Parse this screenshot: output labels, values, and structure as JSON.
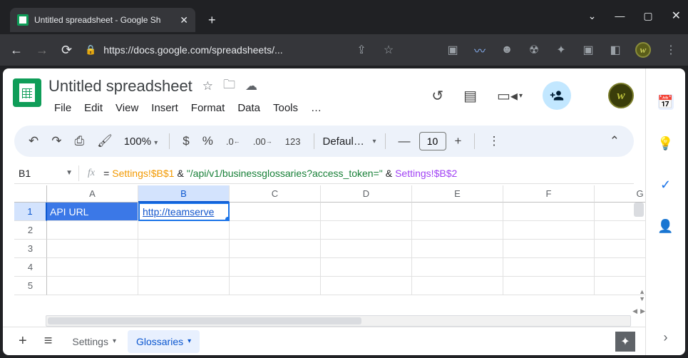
{
  "browser": {
    "tab_title": "Untitled spreadsheet - Google Sh",
    "url_display": "https://docs.google.com/spreadsheets/..."
  },
  "header": {
    "doc_title": "Untitled spreadsheet",
    "menus": [
      "File",
      "Edit",
      "View",
      "Insert",
      "Format",
      "Data",
      "Tools",
      "…"
    ]
  },
  "toolbar": {
    "zoom": "100%",
    "font": "Defaul…",
    "font_size": "10"
  },
  "formula_bar": {
    "cell_ref": "B1",
    "parts": [
      {
        "t": "eq",
        "v": "="
      },
      {
        "t": "ref",
        "v": "Settings!$B$1"
      },
      {
        "t": "op",
        "v": " & "
      },
      {
        "t": "str",
        "v": "\"/api/v1/businessglossaries?access_token=\""
      },
      {
        "t": "op",
        "v": " & "
      },
      {
        "t": "ref2",
        "v": "Settings!$B$2"
      }
    ]
  },
  "grid": {
    "columns": [
      "A",
      "B",
      "C",
      "D",
      "E",
      "F",
      "G"
    ],
    "selected_col": "B",
    "selected_row": 1,
    "row_count": 5,
    "cells": {
      "A1": "API URL",
      "B1": "http://teamserve"
    }
  },
  "sheets": {
    "tabs": [
      {
        "name": "Settings",
        "active": false
      },
      {
        "name": "Glossaries",
        "active": true
      }
    ]
  },
  "sidepanel_icons": [
    "calendar",
    "keep",
    "tasks",
    "contacts"
  ]
}
